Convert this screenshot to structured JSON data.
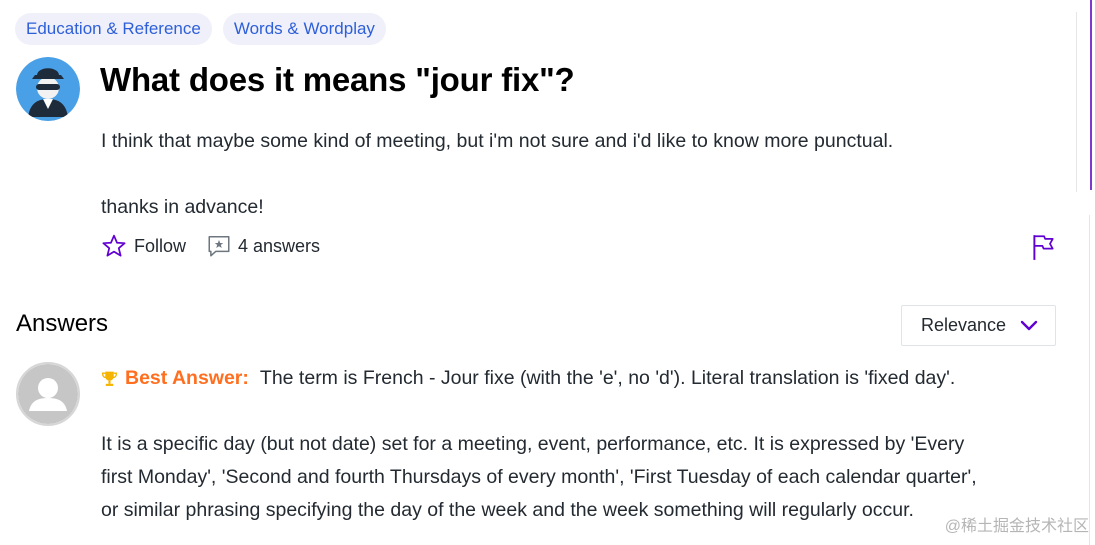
{
  "tags": [
    "Education & Reference",
    "Words & Wordplay"
  ],
  "question": {
    "title": "What does it means \"jour fix\"?",
    "body_line1": "I think that maybe some kind of meeting, but i'm not sure and i'd like to know more punctual.",
    "body_line2": "thanks in advance!"
  },
  "actions": {
    "follow_label": "Follow",
    "answers_label": "4 answers"
  },
  "answers_section": {
    "heading": "Answers",
    "sort_value": "Relevance"
  },
  "best_answer": {
    "label": "Best Answer:",
    "first_line": "The term is French - Jour fixe (with the 'e', no 'd'). Literal translation is 'fixed day'.",
    "para_line1": "It is a specific day (but not date) set for a meeting, event, performance, etc. It is expressed by 'Every",
    "para_line2": "first Monday', 'Second and fourth Thursdays of every month', 'First Tuesday of each calendar quarter',",
    "para_line3": "or similar phrasing specifying the day of the week and the week something will regularly occur."
  },
  "watermark": "@稀土掘金技术社区",
  "colors": {
    "accent": "#6001d2",
    "tag_bg": "#f0f0fb",
    "tag_text": "#2d5fd8",
    "best_answer": "#ff6f1f"
  },
  "icons": {
    "follow": "star-outline-icon",
    "answers": "speech-bubble-star-icon",
    "report": "flag-icon",
    "sort": "chevron-down-icon",
    "best": "trophy-icon"
  }
}
